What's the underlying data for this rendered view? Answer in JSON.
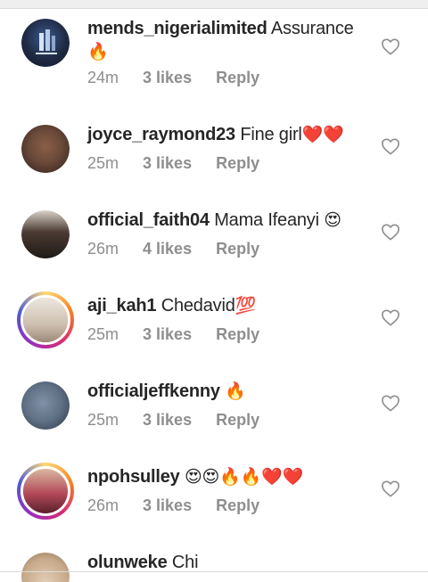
{
  "comments": [
    {
      "username": "mends_nigerialimited",
      "text": "Assurance",
      "emoji": "🔥",
      "time": "24m",
      "likes": "3 likes",
      "reply": "Reply",
      "avatar_color": "#1f2a44",
      "avatar_icon": "building-logo-icon"
    },
    {
      "username": "joyce_raymond23",
      "text": "Fine girl",
      "emoji": "❤️❤️",
      "time": "25m",
      "likes": "3 likes",
      "reply": "Reply",
      "avatar_color": "#6b4a3a",
      "avatar_icon": "profile-photo-icon"
    },
    {
      "username": "official_faith04",
      "text": "Mama Ifeanyi",
      "emoji": "😍",
      "time": "26m",
      "likes": "4 likes",
      "reply": "Reply",
      "avatar_color": "#3a2f2a",
      "avatar_icon": "profile-photo-icon"
    },
    {
      "username": "aji_kah1",
      "text": "Chedavid",
      "emoji": "💯",
      "time": "25m",
      "likes": "3 likes",
      "reply": "Reply",
      "avatar_color": "#cdbfae",
      "avatar_icon": "profile-photo-icon"
    },
    {
      "username": "officialjeffkenny",
      "text": "",
      "emoji": "🔥",
      "time": "25m",
      "likes": "3 likes",
      "reply": "Reply",
      "avatar_color": "#5f7085",
      "avatar_icon": "profile-photo-icon"
    },
    {
      "username": "npohsulley",
      "text": "",
      "emoji": "😍😍🔥🔥❤️❤️",
      "time": "26m",
      "likes": "3 likes",
      "reply": "Reply",
      "avatar_color": "#b44a5a",
      "avatar_icon": "profile-photo-icon"
    },
    {
      "username": "olunweke",
      "text": "Chi",
      "emoji": "",
      "time": "",
      "likes": "",
      "reply": "",
      "avatar_color": "#c7a98a",
      "avatar_icon": "profile-photo-icon"
    }
  ],
  "colors": {
    "text": "#262626",
    "meta": "#8e8e8e",
    "divider": "#dbdbdb"
  }
}
